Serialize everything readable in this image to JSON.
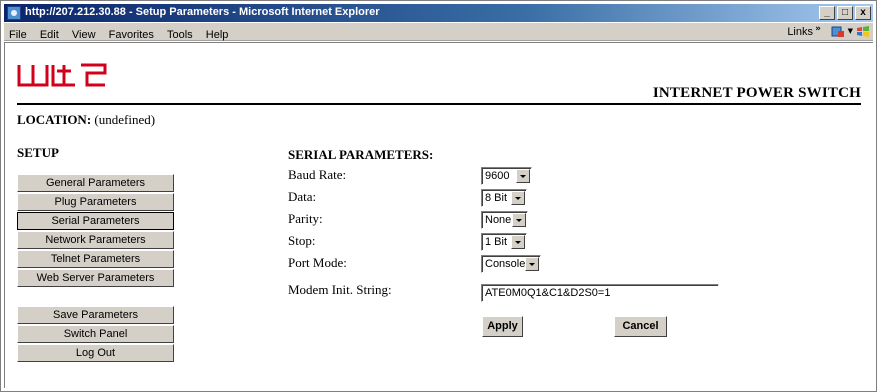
{
  "window": {
    "title": "http://207.212.30.88 - Setup Parameters - Microsoft Internet Explorer",
    "controls": [
      "_",
      "□",
      "x"
    ]
  },
  "menu": {
    "items": [
      "File",
      "Edit",
      "View",
      "Favorites",
      "Tools",
      "Help"
    ],
    "links_label": "Links",
    "chevron": "»"
  },
  "page": {
    "logo_text": "wti",
    "product_name": "INTERNET POWER SWITCH",
    "location_label": "LOCATION:",
    "location_value": "(undefined)",
    "setup_heading": "SETUP"
  },
  "nav": {
    "items": [
      {
        "label": "General Parameters"
      },
      {
        "label": "Plug Parameters"
      },
      {
        "label": "Serial Parameters"
      },
      {
        "label": "Network Parameters"
      },
      {
        "label": "Telnet Parameters"
      },
      {
        "label": "Web Server Parameters"
      }
    ],
    "actions": [
      {
        "label": "Save Parameters"
      },
      {
        "label": "Switch Panel"
      },
      {
        "label": "Log Out"
      }
    ],
    "active": "Serial Parameters"
  },
  "form": {
    "heading": "SERIAL PARAMETERS:",
    "fields": [
      {
        "label": "Baud Rate:",
        "value": "9600"
      },
      {
        "label": "Data:",
        "value": "8 Bit"
      },
      {
        "label": "Parity:",
        "value": "None"
      },
      {
        "label": "Stop:",
        "value": "1 Bit"
      },
      {
        "label": "Port Mode:",
        "value": "Console"
      },
      {
        "label": "Modem Init. String:",
        "value": "ATE0M0Q1&C1&D2S0=1"
      }
    ],
    "apply_label": "Apply",
    "cancel_label": "Cancel"
  },
  "colors": {
    "titlebar": "#0a246a",
    "chrome": "#d4d0c8",
    "logo_red": "#d0021b"
  }
}
